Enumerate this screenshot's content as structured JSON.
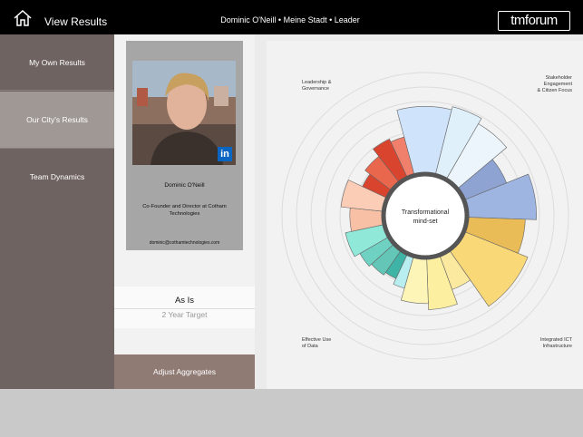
{
  "header": {
    "view_title": "View Results",
    "user_line": "Dominic O'Neill  •  Meine Stadt  •  Leader",
    "logo_text": "tmforum"
  },
  "sidebar": {
    "items": [
      {
        "label": "My Own Results"
      },
      {
        "label": "Our City's Results"
      },
      {
        "label": "Team Dynamics"
      }
    ]
  },
  "profile": {
    "name": "Dominic O'Neill",
    "title": "Co-Founder and Director at Cotham Technologies",
    "email": "dominic@cothamtechnologies.com",
    "badge": "in"
  },
  "legend": {
    "as_is": "As Is",
    "target": "2 Year Target"
  },
  "actions": {
    "adjust": "Adjust Aggregates"
  },
  "chart": {
    "center_label": "Transformational\nmind-set",
    "corners": {
      "top_left": "Leadership &\nGovernance",
      "top_right": "Stakeholder\nEngagement\n& Citizen Focus",
      "bottom_left": "Effective Use\nof Data",
      "bottom_right": "Integrated ICT\nInfrastructure"
    }
  },
  "chart_data": {
    "type": "polar-area",
    "segments": [
      {
        "start": 345,
        "end": 14,
        "as_is": 0.95,
        "color": "#cfe3fa"
      },
      {
        "start": 14,
        "end": 30,
        "as_is": 1.0,
        "color": "#dff0fb"
      },
      {
        "start": 30,
        "end": 50,
        "as_is": 0.9,
        "color": "#ecf5fb"
      },
      {
        "start": 50,
        "end": 68,
        "as_is": 0.6,
        "color": "#8ea3d1"
      },
      {
        "start": 68,
        "end": 92,
        "as_is": 0.98,
        "color": "#9db5e0"
      },
      {
        "start": 92,
        "end": 112,
        "as_is": 0.8,
        "color": "#e9bc57"
      },
      {
        "start": 112,
        "end": 145,
        "as_is": 0.97,
        "color": "#f9d877"
      },
      {
        "start": 145,
        "end": 160,
        "as_is": 0.45,
        "color": "#fce9a0"
      },
      {
        "start": 160,
        "end": 178,
        "as_is": 0.7,
        "color": "#fcf0a0"
      },
      {
        "start": 178,
        "end": 196,
        "as_is": 0.6,
        "color": "#fdf5b8"
      },
      {
        "start": 196,
        "end": 205,
        "as_is": 0.4,
        "color": "#b8eef0"
      },
      {
        "start": 205,
        "end": 215,
        "as_is": 0.3,
        "color": "#3fb3a6"
      },
      {
        "start": 215,
        "end": 228,
        "as_is": 0.35,
        "color": "#63c6b6"
      },
      {
        "start": 228,
        "end": 240,
        "as_is": 0.4,
        "color": "#6fd1c2"
      },
      {
        "start": 240,
        "end": 258,
        "as_is": 0.5,
        "color": "#8fe8d8"
      },
      {
        "start": 258,
        "end": 276,
        "as_is": 0.4,
        "color": "#f8c1a6"
      },
      {
        "start": 276,
        "end": 295,
        "as_is": 0.55,
        "color": "#fbcdb7"
      },
      {
        "start": 295,
        "end": 307,
        "as_is": 0.3,
        "color": "#d9442f"
      },
      {
        "start": 307,
        "end": 322,
        "as_is": 0.4,
        "color": "#e8674d"
      },
      {
        "start": 322,
        "end": 335,
        "as_is": 0.55,
        "color": "#d9442f"
      },
      {
        "start": 335,
        "end": 345,
        "as_is": 0.5,
        "color": "#f0806b"
      }
    ]
  }
}
